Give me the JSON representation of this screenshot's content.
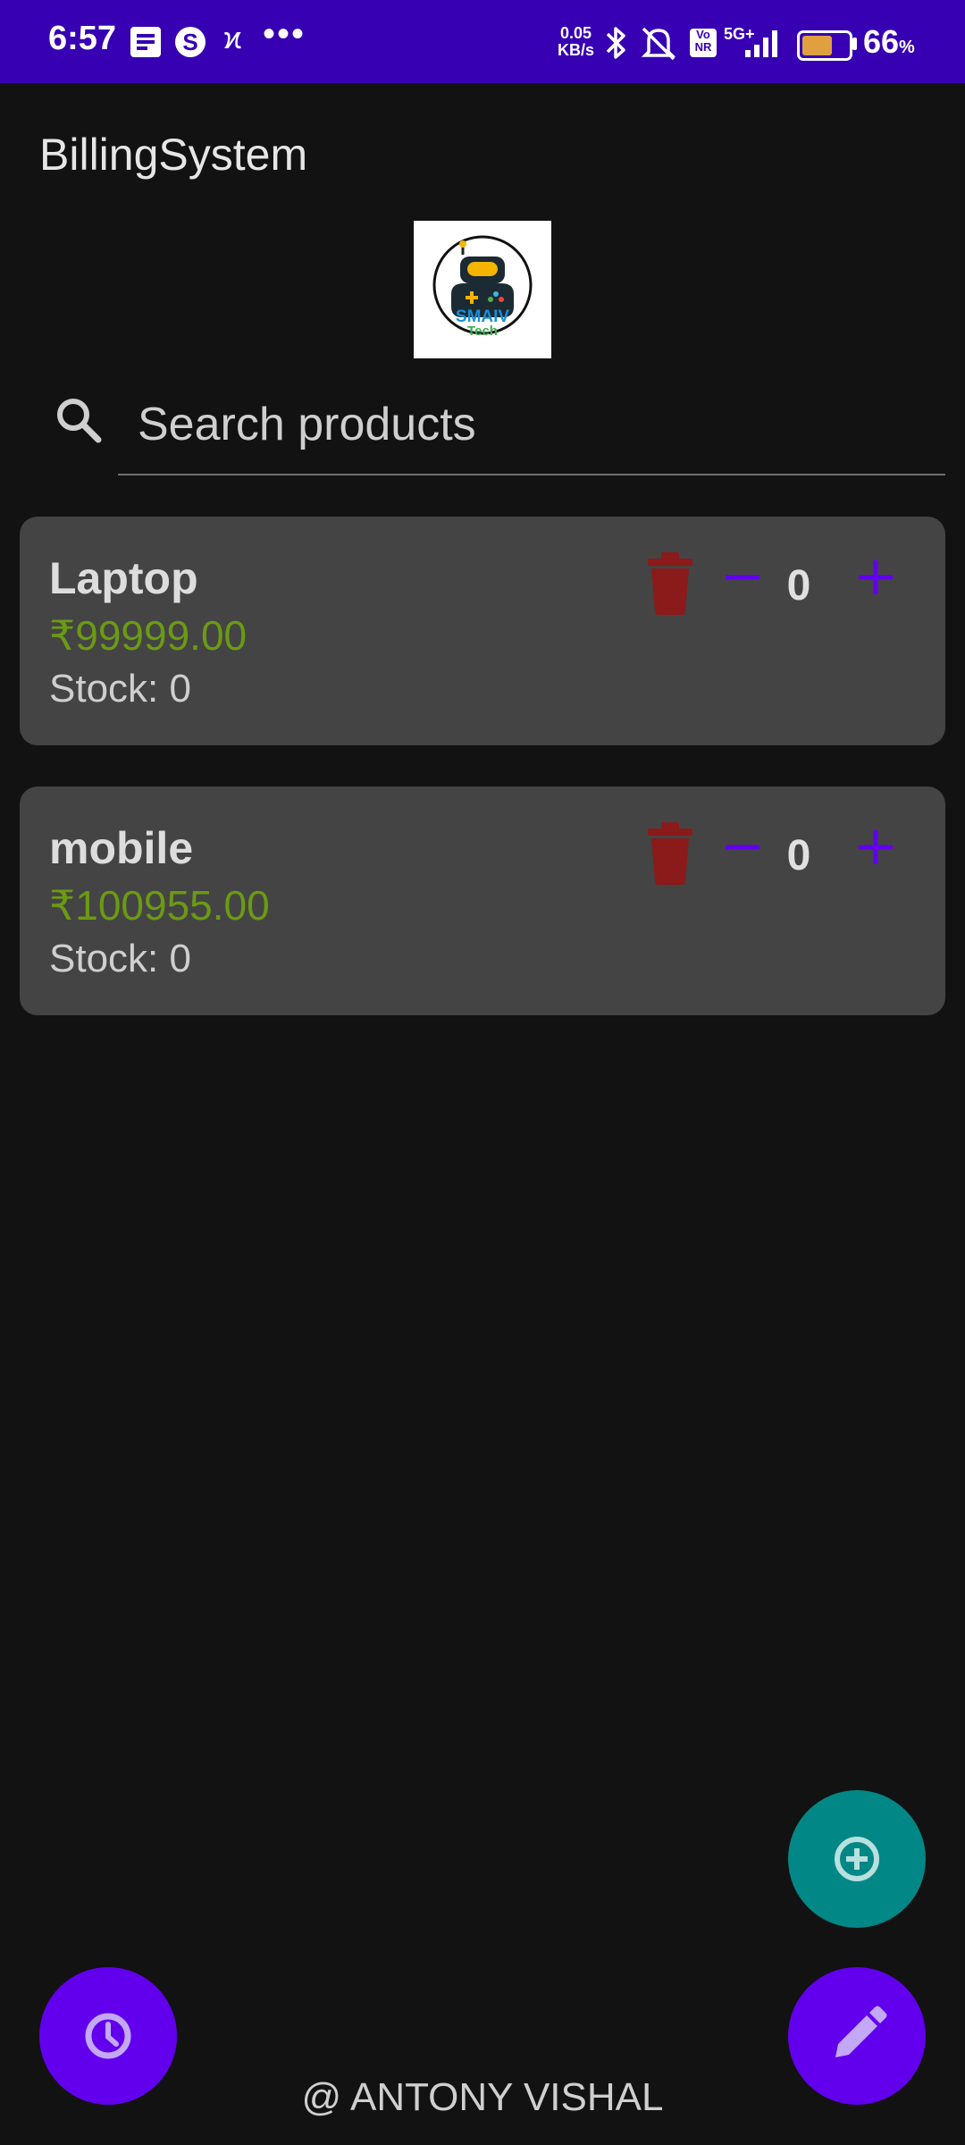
{
  "status_bar": {
    "time": "6:57",
    "speed_value": "0.05",
    "speed_unit": "KB/s",
    "network": "5G+",
    "volte": "Vo NR",
    "battery_level": 66,
    "battery_label": "66",
    "battery_percent_sign": "%"
  },
  "app": {
    "title": "BillingSystem",
    "logo_text_top": "SMAIV",
    "logo_text_bottom": "Tech"
  },
  "search": {
    "placeholder": "Search products"
  },
  "products": [
    {
      "name": "Laptop",
      "price": "₹99999.00",
      "stock": "Stock: 0",
      "quantity": "0"
    },
    {
      "name": "mobile",
      "price": "₹100955.00",
      "stock": "Stock: 0",
      "quantity": "0"
    }
  ],
  "footer": {
    "credit": "@ ANTONY VISHAL"
  },
  "colors": {
    "status_bar": "#3700b3",
    "primary": "#6200ee",
    "teal_fab": "#018786",
    "price_green": "#6b9a14",
    "delete_red": "#8b1a1a",
    "card_bg": "#444444",
    "background": "#121212"
  },
  "icons": {
    "search": "search-icon",
    "delete": "trash-icon",
    "decrease": "minus-icon",
    "increase": "plus-icon",
    "add_product": "add-circle-icon",
    "history": "clock-icon",
    "edit": "pencil-icon"
  }
}
